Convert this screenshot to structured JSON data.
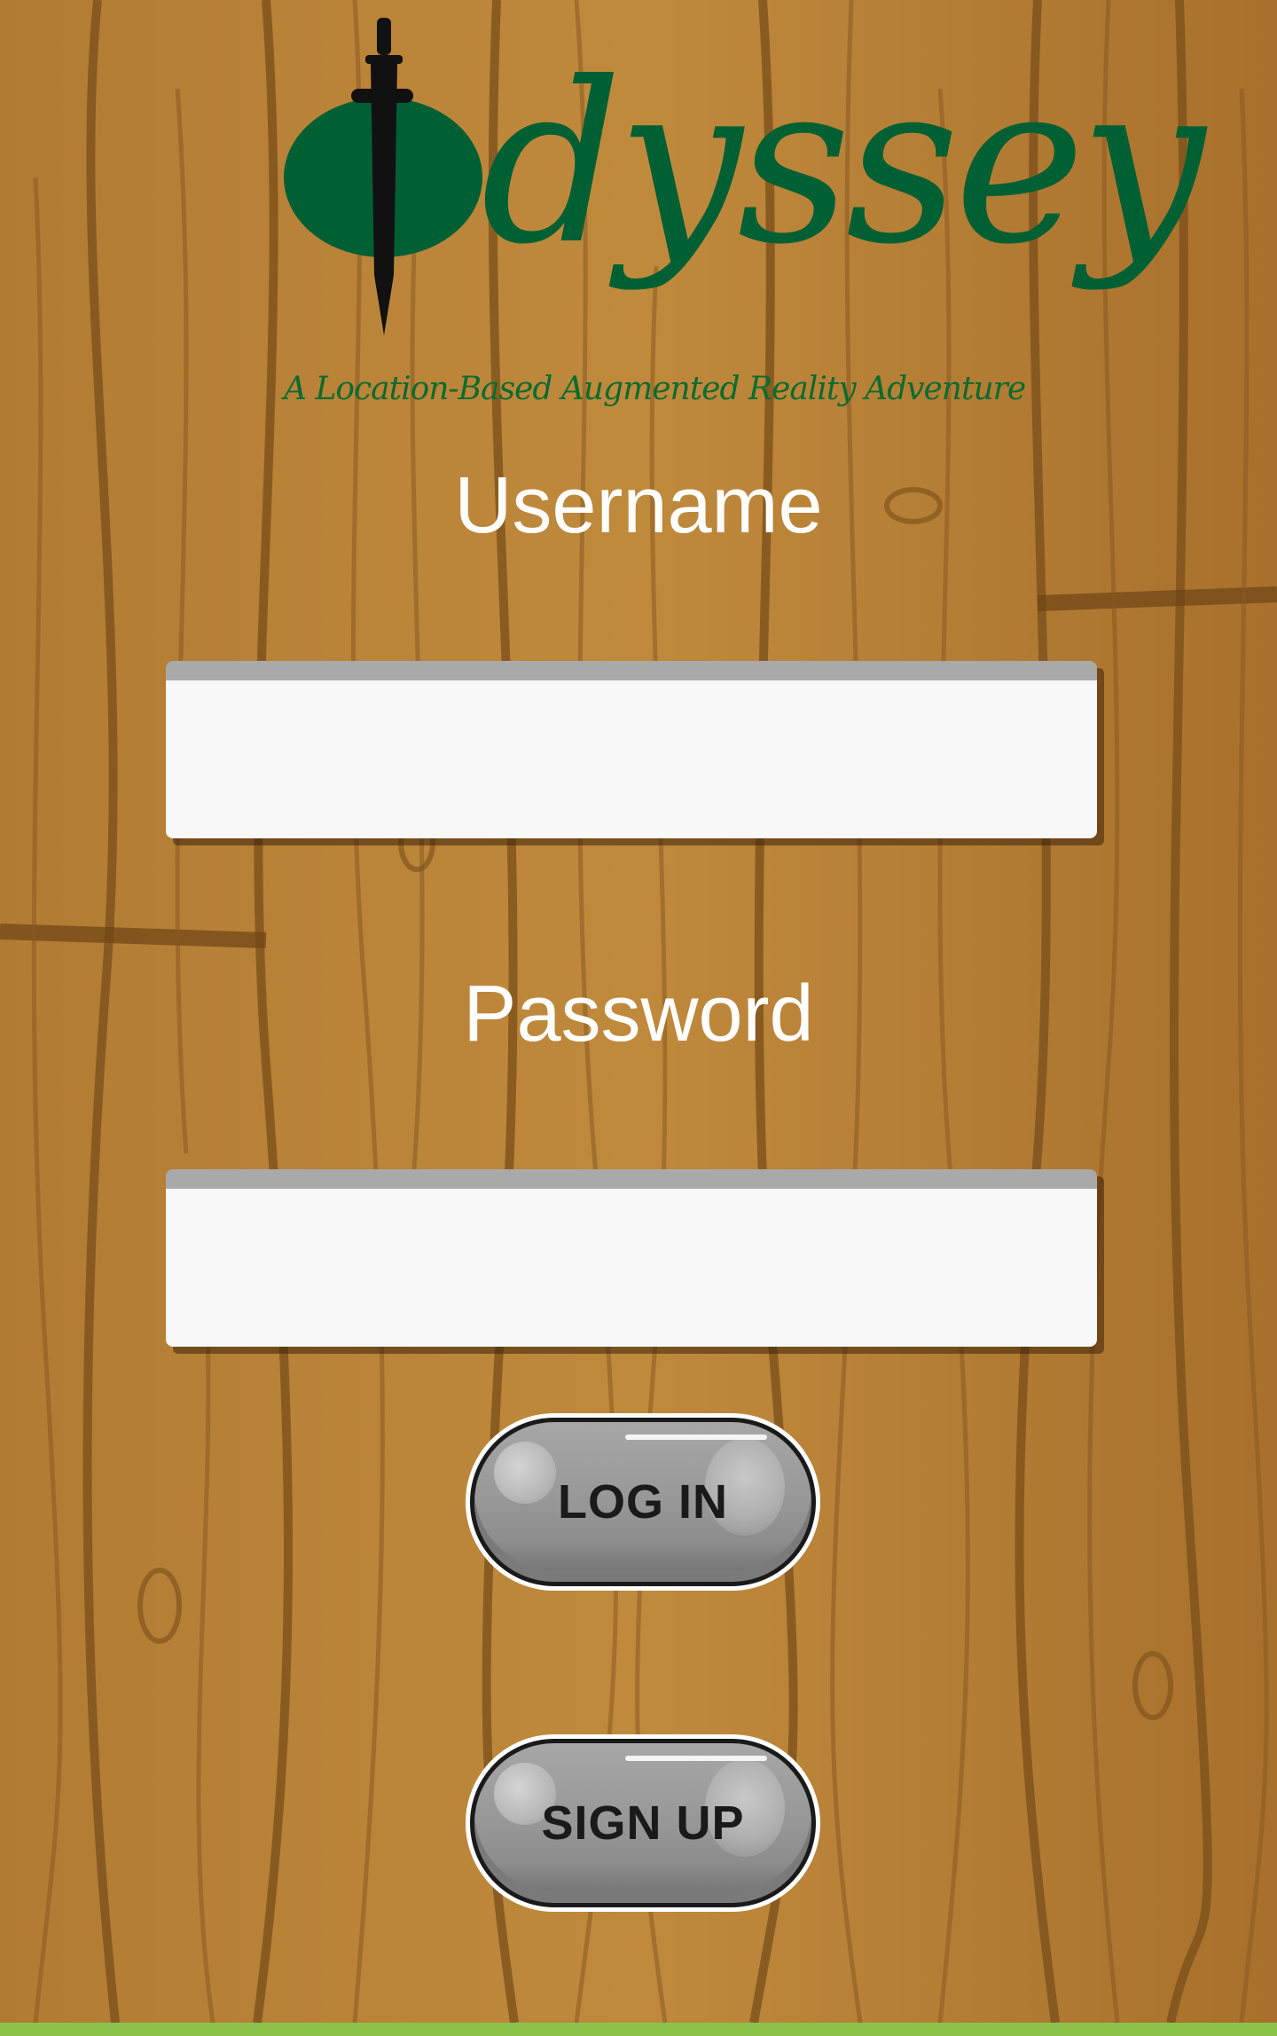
{
  "logo": {
    "wordmark": "dyssey",
    "tagline": "A Location-Based Augmented Reality Adventure"
  },
  "form": {
    "username_label": "Username",
    "username_value": "",
    "password_label": "Password",
    "password_value": ""
  },
  "buttons": {
    "login_label": "LOG IN",
    "signup_label": "SIGN UP"
  },
  "colors": {
    "brand_green": "#006034",
    "wood": "#b07a32",
    "accent_bar": "#8bc34a"
  }
}
